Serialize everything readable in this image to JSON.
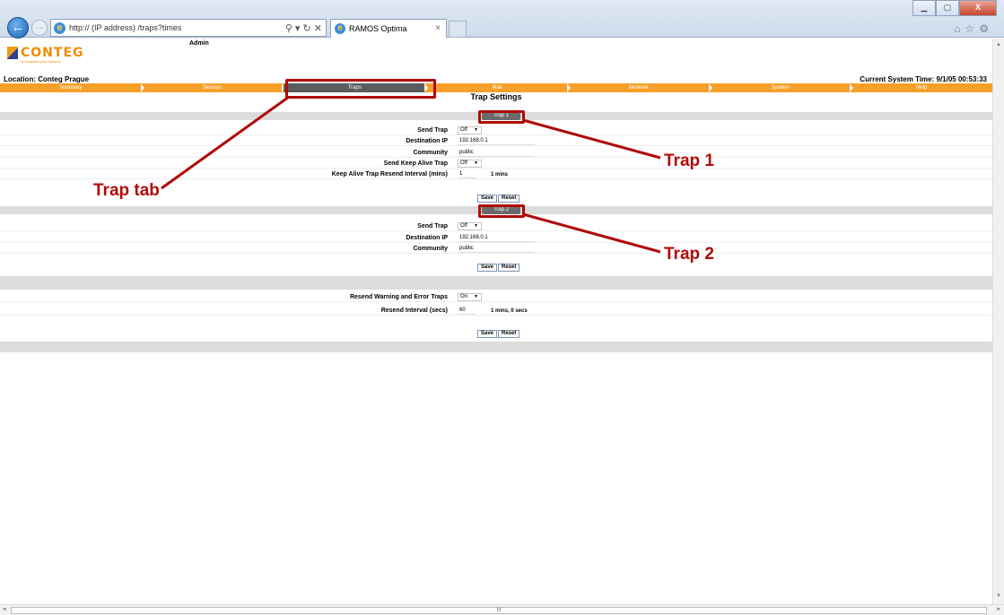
{
  "browser": {
    "url": "http://  (IP address)  /traps?times",
    "tab_title": "RAMOS Optima",
    "address_controls": "⚲ ▾ ↻ ✕",
    "tab_close": "×",
    "back_icon": "←",
    "forward_icon": "→",
    "window_buttons": [
      "▁",
      "▢",
      "X"
    ],
    "toolbar_icons": "⌂☆⚙"
  },
  "header": {
    "logo_text": "CONTEG",
    "logo_tagline": "to complete your network",
    "user": "Admin",
    "location": "Location: Conteg Prague",
    "system_time": "Current System Time: 9/1/05 00:53:33"
  },
  "menu": [
    {
      "label": "Summary"
    },
    {
      "label": "Sensors"
    },
    {
      "label": "Traps",
      "active": true
    },
    {
      "label": "Mail"
    },
    {
      "label": "Network"
    },
    {
      "label": "System"
    },
    {
      "label": "Help"
    }
  ],
  "page_title": "Trap Settings",
  "trap1": {
    "title": "Trap 1",
    "send_trap_label": "Send Trap",
    "send_trap_value": "Off",
    "dest_ip_label": "Destination IP",
    "dest_ip_value": "192.168.0.1",
    "community_label": "Community",
    "community_value": "public",
    "keep_alive_label": "Send Keep Alive Trap",
    "keep_alive_value": "Off",
    "interval_label": "Keep Alive Trap Resend Interval (mins)",
    "interval_value": "1",
    "interval_unit": "1 mins",
    "save": "Save",
    "reset": "Reset"
  },
  "trap2": {
    "title": "Trap 2",
    "send_trap_label": "Send Trap",
    "send_trap_value": "Off",
    "dest_ip_label": "Destination IP",
    "dest_ip_value": "192.168.0.1",
    "community_label": "Community",
    "community_value": "public",
    "save": "Save",
    "reset": "Reset"
  },
  "resend": {
    "resend_label": "Resend Warning and Error Traps",
    "resend_value": "On",
    "interval_label": "Resend Interval (secs)",
    "interval_value": "60",
    "interval_unit": "1 mins, 0 secs",
    "save": "Save",
    "reset": "Reset"
  },
  "annotations": {
    "trap_tab": "Trap tab",
    "trap1": "Trap 1",
    "trap2": "Trap 2"
  },
  "scrollbar": {
    "thumb_grip": "III",
    "left_arrow": "◂",
    "right_arrow": "▸",
    "up_arrow": "▴",
    "down_arrow": "▾"
  },
  "colors": {
    "menu_orange": "#f6a02a",
    "active_tab": "#5c5c5c",
    "annotation_red": "#b00a0a"
  }
}
